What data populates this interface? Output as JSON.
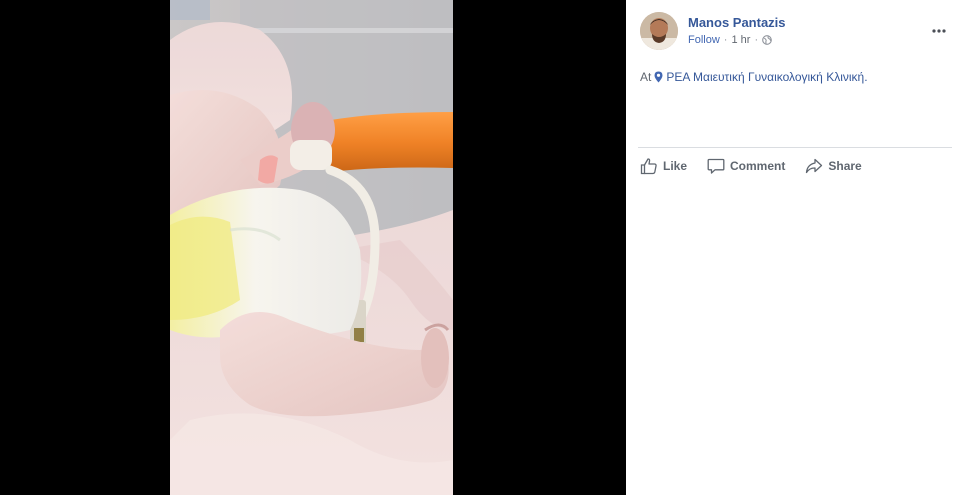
{
  "post": {
    "author": "Manos Pantazis",
    "follow_label": "Follow",
    "separator": "·",
    "timestamp": "1 hr",
    "privacy_icon": "globe-icon",
    "more_icon": "more-dots-icon",
    "checkin_prefix": "At",
    "place_icon": "map-pin-icon",
    "place_name": "ΡΕΑ Μαιευτική Γυναικολογική Κλινική."
  },
  "actions": {
    "like_label": "Like",
    "like_icon": "thumbs-up-icon",
    "comment_label": "Comment",
    "comment_icon": "comment-bubble-icon",
    "share_label": "Share",
    "share_icon": "share-arrow-icon"
  },
  "colors": {
    "theater_background": "#000000",
    "panel_background": "#ffffff",
    "author_link": "#365899",
    "follow_link": "#4267b2",
    "meta_text": "#616770",
    "action_text": "#606770",
    "divider": "#dadde1"
  }
}
